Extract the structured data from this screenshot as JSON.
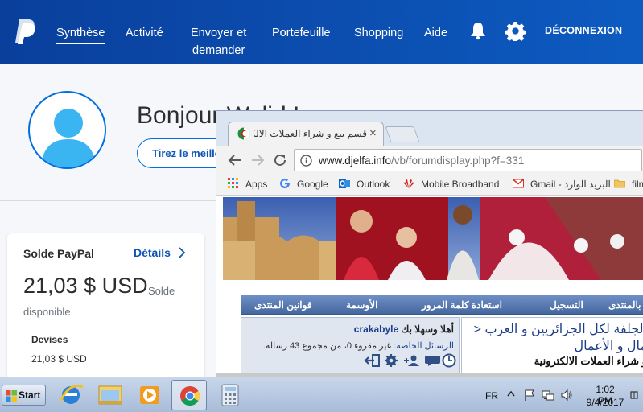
{
  "paypal": {
    "nav": [
      {
        "label": "Synthèse"
      },
      {
        "label": "Activité"
      },
      {
        "label_line1": "Envoyer et",
        "label_line2": "demander"
      },
      {
        "label": "Portefeuille"
      },
      {
        "label": "Shopping"
      },
      {
        "label": "Aide"
      }
    ],
    "logout": "DÉCONNEXION",
    "greeting": "Bonjour Walid !",
    "cta_button": "Tirez le meilleur parti de PayPal",
    "balance": {
      "title": "Solde PayPal",
      "details_link": "Détails",
      "amount": "21,03 $ USD",
      "sub_line1": "Solde",
      "sub_line2": "disponible",
      "currencies_title": "Devises",
      "currency_row": "21,03 $ USD"
    },
    "colors": {
      "header": "#0d5bc1",
      "link": "#0c55b5"
    }
  },
  "browser": {
    "tab_title": "قسم بيع و شراء العملات الالكترونية",
    "tab_close": "×",
    "url_host": "www.djelfa.info",
    "url_path": "/vb/forumdisplay.php?f=331",
    "bookmarks": [
      {
        "label": "Apps",
        "icon": "apps-grid-icon"
      },
      {
        "label": "Google",
        "icon": "google-icon"
      },
      {
        "label": "Outlook",
        "icon": "outlook-icon"
      },
      {
        "label": "Mobile Broadband",
        "icon": "huawei-icon"
      },
      {
        "label": "Gmail - البريد الوارد",
        "icon": "gmail-icon"
      },
      {
        "label": "film",
        "icon": "folder-icon"
      }
    ]
  },
  "forum": {
    "nav": [
      "قوانين المنتدى",
      "الأوسمة",
      "استعادة كلمة المرور",
      "التسجيل",
      "بالمنتدى"
    ],
    "welcome_prefix": "أهلا وسهلا بك ",
    "username": "crakabyle",
    "pm_label": "الرسائل الخاصة:",
    "pm_text": " غير مقروء 0، من مجموع 43 رسالة.",
    "breadcrumb_1": "الجلفة لكل الجزائريين و العرب <",
    "breadcrumb_2": "مال و الأعمال",
    "breadcrumb_3": "و شراء العملات الالكترونية"
  },
  "taskbar": {
    "start": "Start",
    "apps": [
      "internet-explorer-icon",
      "file-explorer-icon",
      "media-player-icon",
      "chrome-icon",
      "calculator-icon"
    ],
    "language": "FR",
    "time": "1:02 PM",
    "date": "9/4/2017"
  }
}
